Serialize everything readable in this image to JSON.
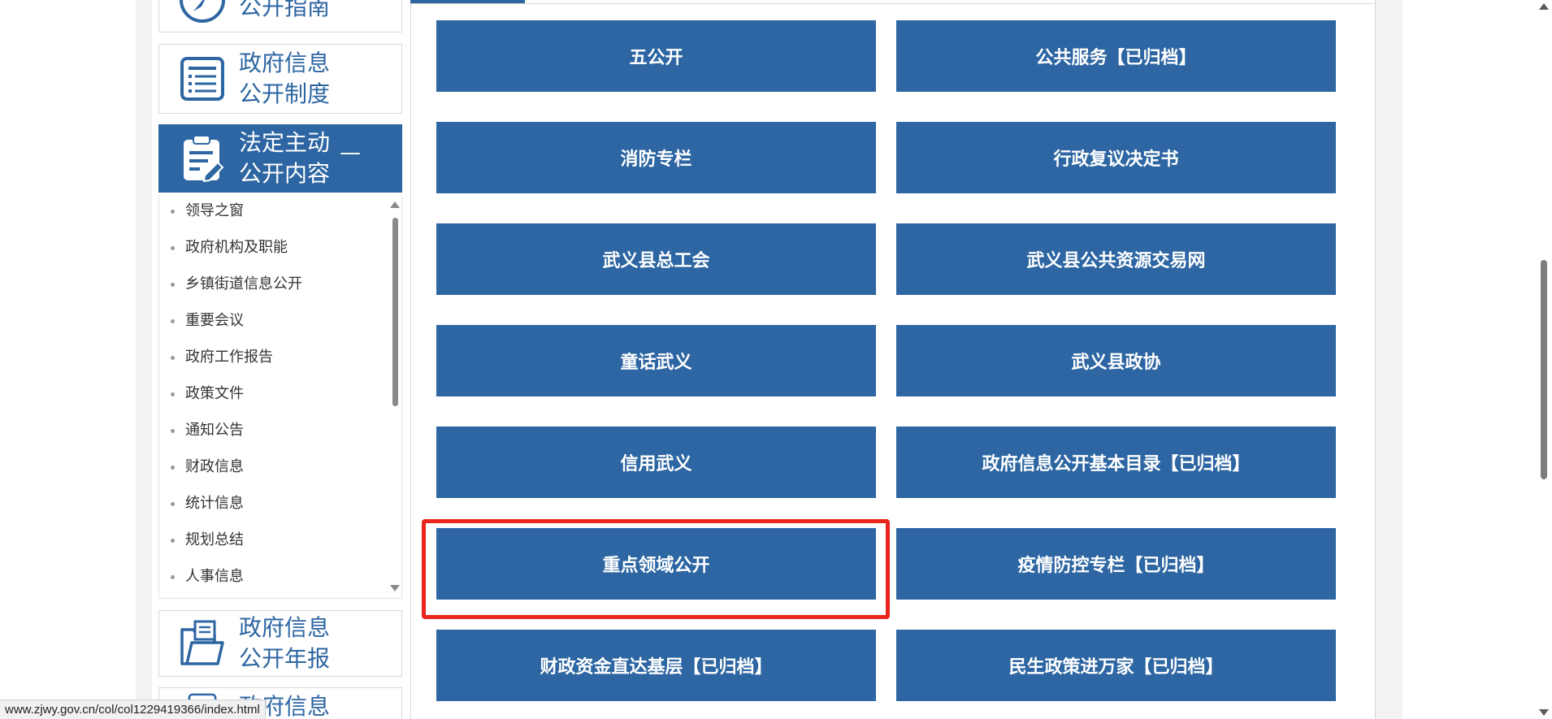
{
  "sidebar": {
    "guide_title": "公开指南",
    "system_title": "政府信息\n公开制度",
    "active_title": "法定主动\n公开内容",
    "active_collapse": "—",
    "submenu": [
      "领导之窗",
      "政府机构及职能",
      "乡镇街道信息公开",
      "重要会议",
      "政府工作报告",
      "政策文件",
      "通知公告",
      "财政信息",
      "统计信息",
      "规划总结",
      "人事信息"
    ],
    "annual_title": "政府信息\n公开年报",
    "next_title": "政府信息"
  },
  "tiles": [
    "五公开",
    "公共服务【已归档】",
    "消防专栏",
    "行政复议决定书",
    "武义县总工会",
    "武义县公共资源交易网",
    "童话武义",
    "武义县政协",
    "信用武义",
    "政府信息公开基本目录【已归档】",
    "重点领域公开",
    "疫情防控专栏【已归档】",
    "财政资金直达基层【已归档】",
    "民生政策进万家【已归档】"
  ],
  "status_url": "www.zjwy.gov.cn/col/col1229419366/index.html",
  "colors": {
    "accent": "#2d66a2",
    "highlight": "#e8261e"
  },
  "icons": [
    "compass-icon",
    "list-document-icon",
    "clipboard-edit-icon",
    "folder-document-icon"
  ]
}
